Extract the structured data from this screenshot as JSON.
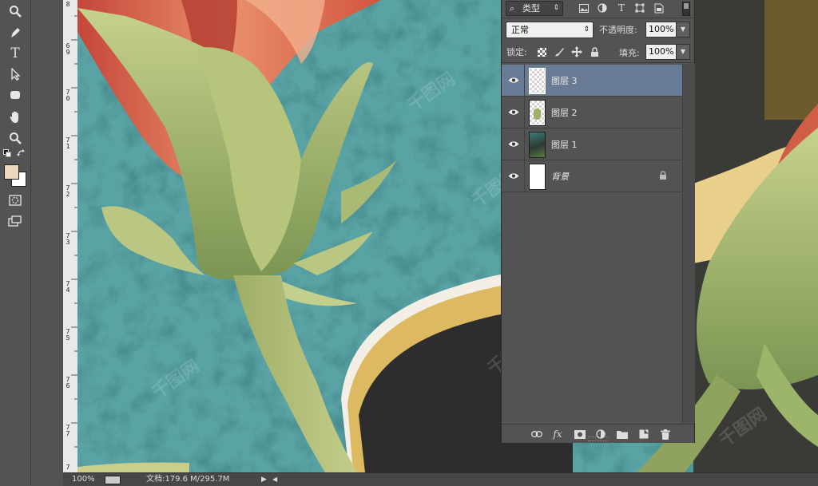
{
  "toolbar": {
    "tools": [
      "zoom-tool",
      "pen-tool",
      "type-tool",
      "path-selection-tool",
      "rectangle-tool",
      "hand-tool",
      "zoom-tool-2",
      "default-colors",
      "swap-colors",
      "foreground-color",
      "background-color",
      "quick-mask",
      "screen-mode"
    ],
    "foreground_color": "#eed8bd",
    "background_color": "#ffffff"
  },
  "ruler": {
    "labels": [
      "8",
      "6 9",
      "7 0",
      "7 1",
      "7 2",
      "7 3",
      "7 4",
      "7 5",
      "7 6",
      "7 7",
      "7"
    ]
  },
  "layers_panel": {
    "filter_kind": "类型",
    "blend_mode": "正常",
    "opacity_label": "不透明度:",
    "opacity_value": "100%",
    "lock_label": "锁定:",
    "fill_label": "填充:",
    "fill_value": "100%",
    "layers": [
      {
        "name": "图层 3",
        "selected": true,
        "visible": true
      },
      {
        "name": "图层 2",
        "selected": false,
        "visible": true
      },
      {
        "name": "图层 1",
        "selected": false,
        "visible": true
      },
      {
        "name": "背景",
        "selected": false,
        "visible": true,
        "locked": true
      }
    ],
    "bottom_icons": [
      "link-icon",
      "fx-icon",
      "mask-icon",
      "adjustment-icon",
      "folder-icon",
      "new-layer-icon",
      "trash-icon"
    ],
    "fx_label": "fx"
  },
  "statusbar": {
    "zoom": "100%",
    "doc_info": "文档:179.6 M/295.7M"
  },
  "watermark": "千图网"
}
